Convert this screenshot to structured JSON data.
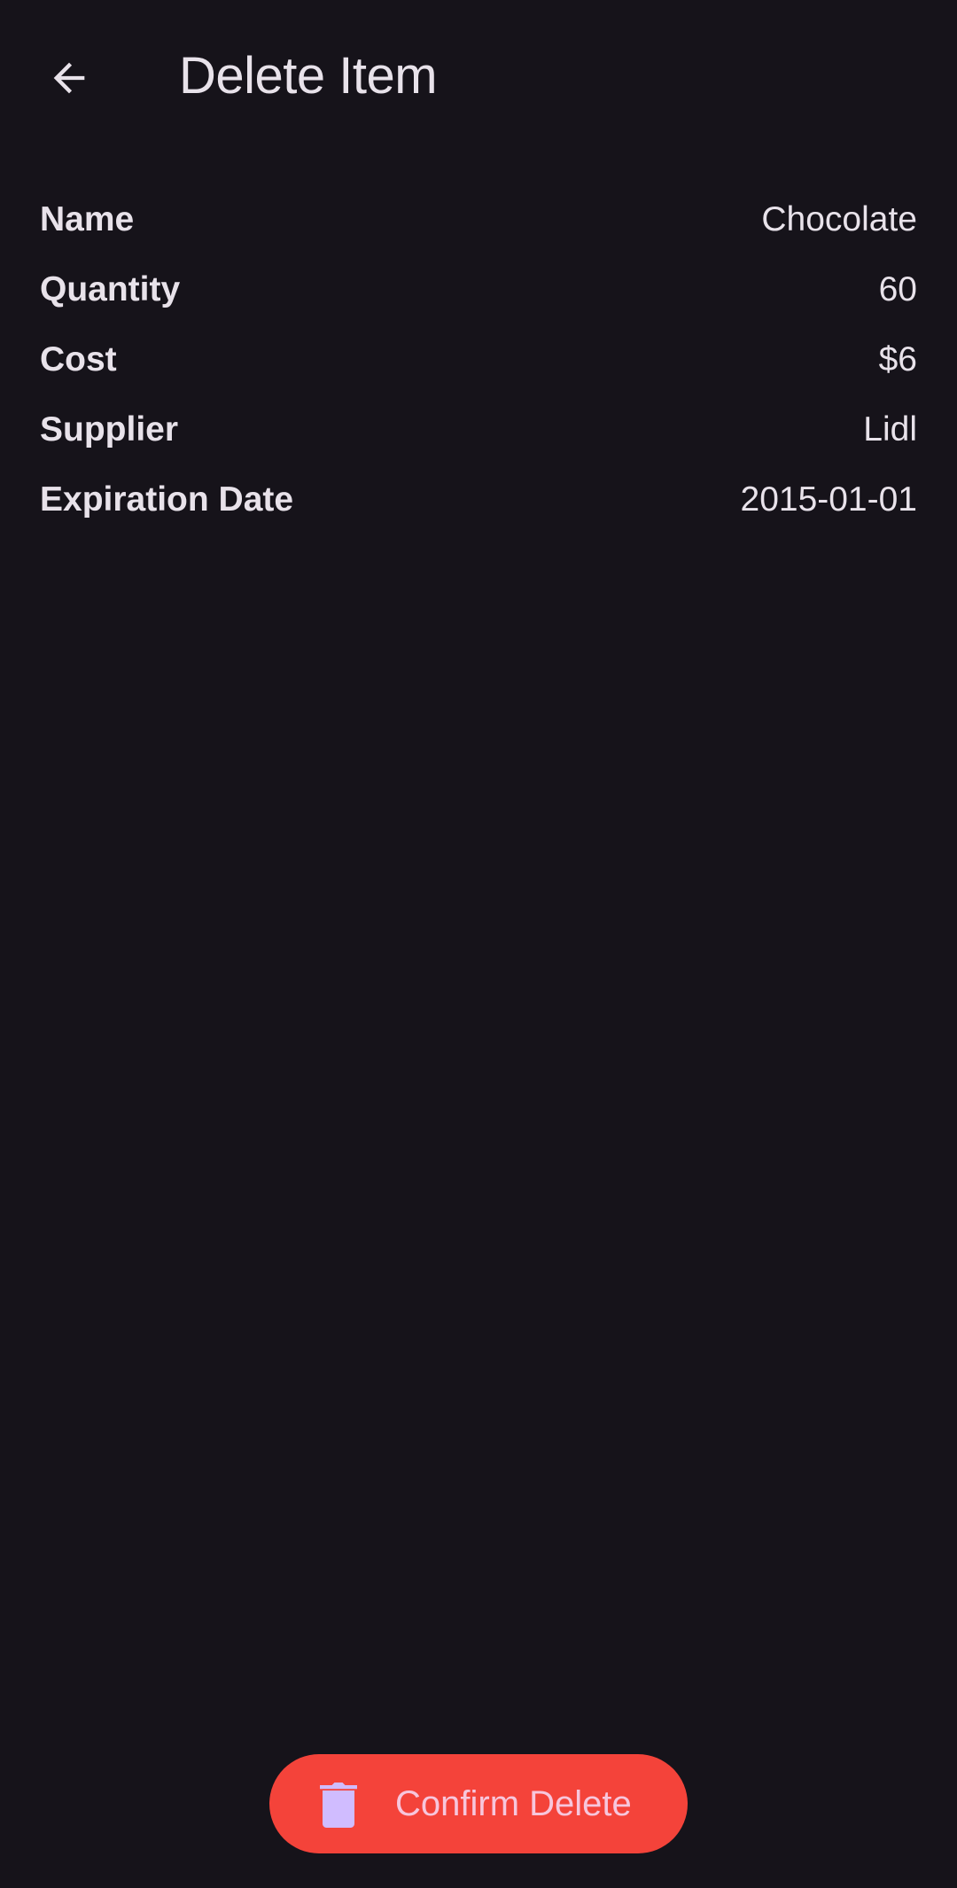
{
  "header": {
    "back_icon": "arrow-back-icon",
    "title": "Delete Item"
  },
  "details": [
    {
      "label": "Name",
      "value": "Chocolate"
    },
    {
      "label": "Quantity",
      "value": "60"
    },
    {
      "label": "Cost",
      "value": "$6"
    },
    {
      "label": "Supplier",
      "value": "Lidl"
    },
    {
      "label": "Expiration Date",
      "value": "2015-01-01"
    }
  ],
  "action": {
    "icon": "trash-icon",
    "label": "Confirm Delete"
  },
  "colors": {
    "background": "#16131a",
    "text": "#e8e2ea",
    "danger": "#f4433a",
    "button_text": "#f7c6dc",
    "icon_tint": "#d0bcff"
  }
}
